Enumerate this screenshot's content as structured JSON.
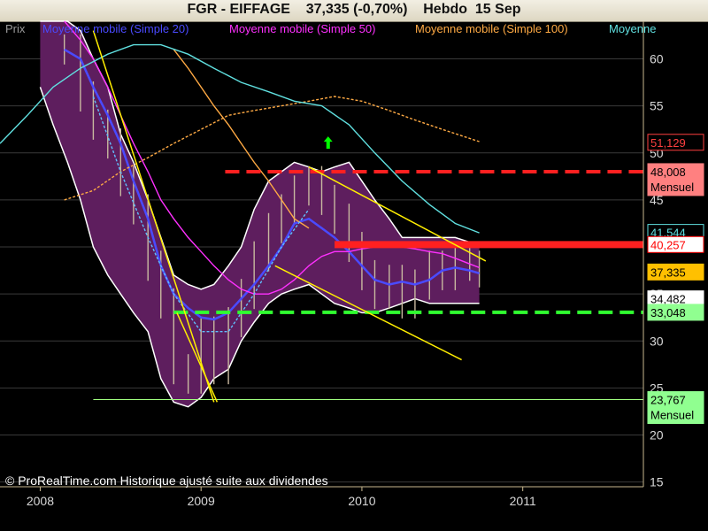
{
  "header": {
    "title": "FGR - EIFFAGE    37,335 (-0,70%)    Hebdo  15 Sep"
  },
  "legend": [
    {
      "label": "Prix",
      "color": "#9a9a9a"
    },
    {
      "label": "Moyenne mobile (Simple 20)",
      "color": "#4a4aff"
    },
    {
      "label": "Moyenne mobile (Simple 50)",
      "color": "#ff30ff"
    },
    {
      "label": "Moyenne mobile (Simple 100)",
      "color": "#ffaa44"
    },
    {
      "label": "Moyenne",
      "color": "#60e0e0"
    }
  ],
  "footer": {
    "copyright": "© ProRealTime.com Historique ajusté suite aux dividendes"
  },
  "chart_data": {
    "type": "line",
    "y_ticks": [
      15,
      20,
      25,
      30,
      35,
      40,
      45,
      50,
      55,
      60
    ],
    "ylim": [
      14.5,
      64
    ],
    "x_ticks": [
      "2008",
      "2009",
      "2010",
      "2011"
    ],
    "xlim": [
      2007.75,
      2011.75
    ],
    "grid": true,
    "price_badges": [
      {
        "value": 51.129,
        "label": "51,129",
        "sublabel": "",
        "bg": "#000000",
        "fg": "#ff4040",
        "border": "#ff4040"
      },
      {
        "value": 48.008,
        "label": "48,008",
        "sublabel": "Mensuel",
        "bg": "#ff8080",
        "fg": "#000000",
        "border": "#ff8080"
      },
      {
        "value": 41.544,
        "label": "41,544",
        "sublabel": "",
        "bg": "#000000",
        "fg": "#60e0e0",
        "border": "#60e0e0"
      },
      {
        "value": 40.257,
        "label": "40,257",
        "sublabel": "",
        "bg": "#ffffff",
        "fg": "#ff0000",
        "border": "#ff0000"
      },
      {
        "value": 37.335,
        "label": "37,335",
        "sublabel": "",
        "bg": "#ffc000",
        "fg": "#000000",
        "border": "#ffc000"
      },
      {
        "value": 34.482,
        "label": "34,482",
        "sublabel": "",
        "bg": "#ffffff",
        "fg": "#000000",
        "border": "#ffffff"
      },
      {
        "value": 33.048,
        "label": "33,048",
        "sublabel": "",
        "bg": "#90ff90",
        "fg": "#000000",
        "border": "#90ff90"
      },
      {
        "value": 23.767,
        "label": "23,767",
        "sublabel": "Mensuel",
        "bg": "#90ff90",
        "fg": "#000000",
        "border": "#90ff90"
      }
    ],
    "levels": [
      {
        "value": 48.0,
        "x_start": 2009.15,
        "x_end": 2011.75,
        "color": "#ff2020",
        "style": "dashed"
      },
      {
        "value": 40.25,
        "x_start": 2009.83,
        "x_end": 2011.75,
        "color": "#ff2020",
        "style": "solid"
      },
      {
        "value": 33.05,
        "x_start": 2008.83,
        "x_end": 2011.75,
        "color": "#30ff30",
        "style": "dashed"
      },
      {
        "value": 23.77,
        "x_start": 2008.33,
        "x_end": 2011.75,
        "color": "#a0ff80",
        "style": "thin"
      }
    ],
    "trendlines": [
      {
        "x": [
          2008.33,
          2009.08
        ],
        "y": [
          63.0,
          23.5
        ]
      },
      {
        "x": [
          2008.85,
          2009.1
        ],
        "y": [
          33.0,
          23.5
        ]
      },
      {
        "x": [
          2009.67,
          2010.77
        ],
        "y": [
          48.5,
          38.5
        ]
      },
      {
        "x": [
          2009.46,
          2010.62
        ],
        "y": [
          38.0,
          28.0
        ]
      }
    ],
    "arrow": {
      "x": 2009.79,
      "y": 51.0,
      "color": "#00ff00"
    },
    "series": [
      {
        "name": "Moyenne mobile (Simple 20)",
        "color": "#4a4aff",
        "x": [
          2008.15,
          2008.25,
          2008.33,
          2008.42,
          2008.5,
          2008.58,
          2008.67,
          2008.75,
          2008.83,
          2008.92,
          2009.0,
          2009.08,
          2009.17,
          2009.25,
          2009.33,
          2009.42,
          2009.5,
          2009.58,
          2009.67,
          2009.75,
          2009.83,
          2009.92,
          2010.0,
          2010.08,
          2010.17,
          2010.25,
          2010.33,
          2010.42,
          2010.5,
          2010.58,
          2010.67,
          2010.73
        ],
        "y": [
          61,
          60,
          57,
          54,
          51,
          47,
          43,
          38,
          35,
          33.5,
          32.5,
          32.3,
          33,
          34.5,
          36,
          38,
          40,
          42.5,
          43,
          42,
          41,
          39.5,
          38,
          36.5,
          36,
          36.3,
          36,
          36.5,
          37.5,
          37.8,
          37.5,
          37.2
        ]
      },
      {
        "name": "Moyenne mobile (Simple 50)",
        "color": "#ff30ff",
        "x": [
          2008.15,
          2008.25,
          2008.33,
          2008.42,
          2008.5,
          2008.58,
          2008.67,
          2008.75,
          2008.83,
          2008.92,
          2009.0,
          2009.08,
          2009.17,
          2009.25,
          2009.33,
          2009.42,
          2009.5,
          2009.58,
          2009.67,
          2009.75,
          2009.83,
          2009.92,
          2010.0,
          2010.08,
          2010.17,
          2010.25,
          2010.33,
          2010.42,
          2010.5,
          2010.58,
          2010.67,
          2010.73
        ],
        "y": [
          64,
          62,
          60,
          57,
          54,
          51,
          48,
          45,
          43,
          41,
          39.5,
          38,
          36.5,
          35.5,
          35,
          35,
          35.5,
          36.5,
          38,
          39,
          39.5,
          39.5,
          39.8,
          40,
          40,
          40,
          39.8,
          39.5,
          39.3,
          38.8,
          38.2,
          37.8
        ]
      },
      {
        "name": "Moyenne mobile (Simple 100)",
        "color": "#ffaa44",
        "x": [
          2008.83,
          2008.92,
          2009.0,
          2009.08,
          2009.17,
          2009.25,
          2009.33,
          2009.42,
          2009.5,
          2009.58,
          2009.67
        ],
        "y": [
          61,
          59,
          57,
          55,
          53,
          51,
          49,
          47,
          45,
          43,
          42
        ]
      },
      {
        "name": "",
        "color": "#ffaa44",
        "dashed": true,
        "x": [
          2008.15,
          2008.33,
          2008.5,
          2008.67,
          2008.83,
          2009.0,
          2009.17,
          2009.33,
          2009.5,
          2009.67,
          2009.83,
          2010.0,
          2010.17,
          2010.33,
          2010.5,
          2010.73
        ],
        "y": [
          45,
          46,
          48,
          49.5,
          51,
          52.5,
          54,
          54.5,
          55,
          55.5,
          56,
          55.5,
          54.5,
          53.5,
          52.5,
          51.2
        ]
      },
      {
        "name": "",
        "color": "#60e0e0",
        "x": [
          2007.75,
          2007.92,
          2008.08,
          2008.25,
          2008.42,
          2008.58,
          2008.75,
          2008.92,
          2009.08,
          2009.25,
          2009.42,
          2009.58,
          2009.75,
          2009.92,
          2010.08,
          2010.25,
          2010.42,
          2010.58,
          2010.73
        ],
        "y": [
          51,
          54,
          57,
          59,
          60.5,
          61.5,
          61.5,
          60.5,
          59,
          57.5,
          56.5,
          55.5,
          55,
          53,
          50,
          47,
          44.5,
          42.5,
          41.5
        ]
      },
      {
        "name": "",
        "color": "#60c0ff",
        "dashed": true,
        "x": [
          2008.33,
          2008.5,
          2008.67,
          2008.83,
          2009.0,
          2009.17,
          2009.33,
          2009.5,
          2009.67
        ],
        "y": [
          56,
          48,
          41,
          35,
          31,
          31,
          35,
          40,
          44
        ]
      }
    ],
    "band": {
      "upper": {
        "x": [
          2008.0,
          2008.08,
          2008.17,
          2008.25,
          2008.33,
          2008.42,
          2008.5,
          2008.58,
          2008.67,
          2008.75,
          2008.83,
          2008.92,
          2009.0,
          2009.08,
          2009.17,
          2009.25,
          2009.33,
          2009.42,
          2009.5,
          2009.58,
          2009.67,
          2009.75,
          2009.83,
          2009.92,
          2010.0,
          2010.08,
          2010.17,
          2010.25,
          2010.33,
          2010.42,
          2010.5,
          2010.58,
          2010.67,
          2010.73
        ],
        "y": [
          64,
          64,
          64,
          63,
          60,
          57,
          52,
          49,
          45,
          41,
          37,
          36,
          35.5,
          36,
          38,
          40,
          44,
          47,
          48,
          49,
          48.5,
          48,
          48.5,
          49,
          47,
          45,
          43,
          41,
          41,
          41,
          41,
          41,
          40.5,
          40
        ]
      },
      "lower": {
        "x": [
          2008.0,
          2008.08,
          2008.17,
          2008.25,
          2008.33,
          2008.42,
          2008.5,
          2008.58,
          2008.67,
          2008.75,
          2008.83,
          2008.92,
          2009.0,
          2009.08,
          2009.17,
          2009.25,
          2009.33,
          2009.42,
          2009.5,
          2009.58,
          2009.67,
          2009.75,
          2009.83,
          2009.92,
          2010.0,
          2010.08,
          2010.17,
          2010.25,
          2010.33,
          2010.42,
          2010.5,
          2010.58,
          2010.67,
          2010.73
        ],
        "y": [
          57,
          53,
          49,
          45,
          40,
          37,
          35,
          33,
          31,
          26,
          23.5,
          23,
          24,
          26,
          27,
          30,
          32,
          34,
          35,
          35.5,
          36,
          35,
          34,
          33.5,
          33,
          33,
          33.5,
          34,
          34.5,
          34,
          34,
          34,
          34,
          34
        ]
      }
    },
    "candles": {
      "x": [
        2008.15,
        2008.25,
        2008.33,
        2008.42,
        2008.5,
        2008.58,
        2008.67,
        2008.75,
        2008.83,
        2008.92,
        2009.0,
        2009.08,
        2009.17,
        2009.25,
        2009.33,
        2009.42,
        2009.5,
        2009.58,
        2009.67,
        2009.75,
        2009.83,
        2009.92,
        2010.0,
        2010.08,
        2010.17,
        2010.25,
        2010.33,
        2010.42,
        2010.5,
        2010.58,
        2010.67,
        2010.73
      ],
      "y": [
        61,
        56,
        53,
        51,
        47,
        44,
        38,
        34,
        27,
        26,
        31,
        27,
        32,
        35,
        39,
        42,
        44,
        46,
        47,
        45,
        43,
        40,
        37,
        35,
        36.5,
        34,
        36,
        38,
        37,
        38.5,
        38,
        37.3
      ]
    }
  }
}
